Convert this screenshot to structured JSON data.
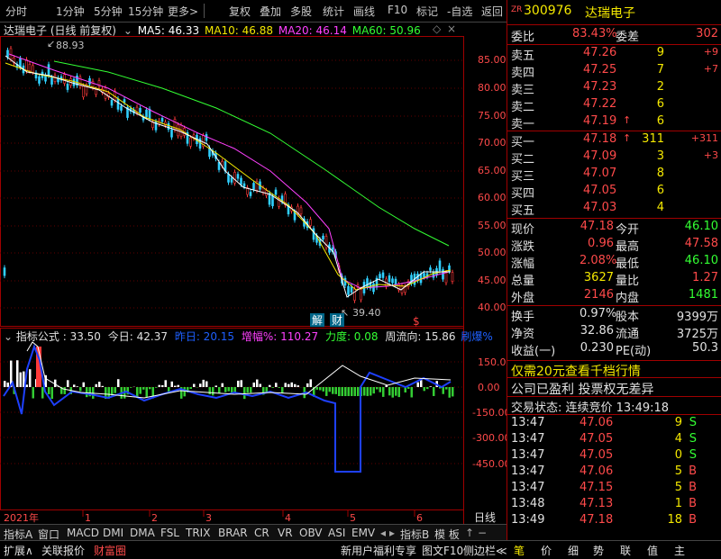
{
  "toolbar": {
    "items": [
      "分时",
      "1分钟",
      "5分钟",
      "15分钟",
      "更多>",
      "复权",
      "叠加",
      "多股",
      "统计",
      "画线",
      "F10",
      "标记",
      "-自选",
      "返回"
    ]
  },
  "chart": {
    "stock_title": "达瑞电子 (日线 前复权)",
    "ma": [
      {
        "label": "MA5: 46.33",
        "color": "#ffffff"
      },
      {
        "label": "MA10: 46.88",
        "color": "#f4e800"
      },
      {
        "label": "MA20: 46.14",
        "color": "#ff40ff"
      },
      {
        "label": "MA60: 50.96",
        "color": "#33ff33"
      }
    ],
    "price_ticks": [
      "85.00",
      "80.00",
      "75.00",
      "70.00",
      "65.00",
      "60.00",
      "55.00",
      "50.00",
      "45.00",
      "40.00"
    ],
    "high_label": "88.93",
    "low_label": "39.40",
    "marker_jie": "解",
    "marker_cai": "财",
    "marker_s": "$"
  },
  "indicator": {
    "name": "指标公式",
    "value": ": 33.50",
    "today_label": "今日: 42.37",
    "yesterday_label": "昨日: 20.15",
    "zengfu_label": "增幅%: 110.27",
    "lidu_label": "力度: 0.08",
    "zhouliu_label": "周流向: 15.86",
    "extra_label": "刷爆%",
    "ticks": [
      "150.00",
      "0.00",
      "-150.00",
      "-300.00",
      "-450.00"
    ]
  },
  "time_axis": {
    "labels": [
      "2021年",
      "1",
      "2",
      "3",
      "4",
      "5",
      "6"
    ],
    "period": "日线"
  },
  "bottom_tabs": [
    "指标A",
    "窗口",
    "MACD",
    "DMI",
    "DMA",
    "FSL",
    "TRIX",
    "BRAR",
    "CR",
    "VR",
    "OBV",
    "ASI",
    "EMV",
    "指标B",
    "模 板"
  ],
  "bottom_bar": {
    "left": [
      "扩展∧",
      "关联报价",
      "财富圈"
    ],
    "right": [
      "新用户福利专享",
      "图文F10",
      "侧边栏≪"
    ],
    "side_tabs": [
      "笔",
      "价",
      "细",
      "势",
      "联",
      "值",
      "主"
    ]
  },
  "quote": {
    "zr": "ZR",
    "code": "300976",
    "name": "达瑞电子",
    "weibi_label": "委比",
    "weibi": "83.43%",
    "weicha_label": "委差",
    "weicha": "302",
    "sells": [
      {
        "label": "卖五",
        "price": "47.26",
        "vol": "9",
        "chg": "+9",
        "arrow": ""
      },
      {
        "label": "卖四",
        "price": "47.25",
        "vol": "7",
        "chg": "+7",
        "arrow": ""
      },
      {
        "label": "卖三",
        "price": "47.23",
        "vol": "2",
        "chg": "",
        "arrow": ""
      },
      {
        "label": "卖二",
        "price": "47.22",
        "vol": "6",
        "chg": "",
        "arrow": ""
      },
      {
        "label": "卖一",
        "price": "47.19",
        "vol": "6",
        "chg": "",
        "arrow": "↑"
      }
    ],
    "buys": [
      {
        "label": "买一",
        "price": "47.18",
        "vol": "311",
        "chg": "+311",
        "arrow": "↑"
      },
      {
        "label": "买二",
        "price": "47.09",
        "vol": "3",
        "chg": "+3",
        "arrow": ""
      },
      {
        "label": "买三",
        "price": "47.07",
        "vol": "8",
        "chg": "",
        "arrow": ""
      },
      {
        "label": "买四",
        "price": "47.05",
        "vol": "6",
        "chg": "",
        "arrow": ""
      },
      {
        "label": "买五",
        "price": "47.03",
        "vol": "4",
        "chg": "",
        "arrow": ""
      }
    ],
    "stats": [
      {
        "l1": "现价",
        "v1": "47.18",
        "c1": "red",
        "l2": "今开",
        "v2": "46.10",
        "c2": "grn"
      },
      {
        "l1": "涨跌",
        "v1": "0.96",
        "c1": "red",
        "l2": "最高",
        "v2": "47.58",
        "c2": "red"
      },
      {
        "l1": "涨幅",
        "v1": "2.08%",
        "c1": "red",
        "l2": "最低",
        "v2": "46.10",
        "c2": "grn"
      },
      {
        "l1": "总量",
        "v1": "3627",
        "c1": "yel",
        "l2": "量比",
        "v2": "1.27",
        "c2": "red"
      },
      {
        "l1": "外盘",
        "v1": "2146",
        "c1": "red",
        "l2": "内盘",
        "v2": "1481",
        "c2": "grn"
      }
    ],
    "stats2": [
      {
        "l1": "换手",
        "v1": "0.97%",
        "l2": "股本",
        "v2": "9399万"
      },
      {
        "l1": "净资",
        "v1": "32.86",
        "l2": "流通",
        "v2": "3725万"
      },
      {
        "l1": "收益(一)",
        "v1": "0.230",
        "l2": "PE(动)",
        "v2": "50.3"
      }
    ],
    "promo": "仅需20元查看千档行情",
    "notice": "公司已盈利 投票权无差异",
    "trade_state": "交易状态: 连续竞价 13:49:18",
    "ticks": [
      {
        "time": "13:47",
        "price": "47.06",
        "vol": "9",
        "bs": "S"
      },
      {
        "time": "13:47",
        "price": "47.05",
        "vol": "4",
        "bs": "S"
      },
      {
        "time": "13:47",
        "price": "47.05",
        "vol": "0",
        "bs": "S"
      },
      {
        "time": "13:47",
        "price": "47.06",
        "vol": "5",
        "bs": "B"
      },
      {
        "time": "13:47",
        "price": "47.15",
        "vol": "5",
        "bs": "B"
      },
      {
        "time": "13:48",
        "price": "47.13",
        "vol": "1",
        "bs": "B"
      },
      {
        "time": "13:49",
        "price": "47.18",
        "vol": "18",
        "bs": "B"
      }
    ]
  }
}
